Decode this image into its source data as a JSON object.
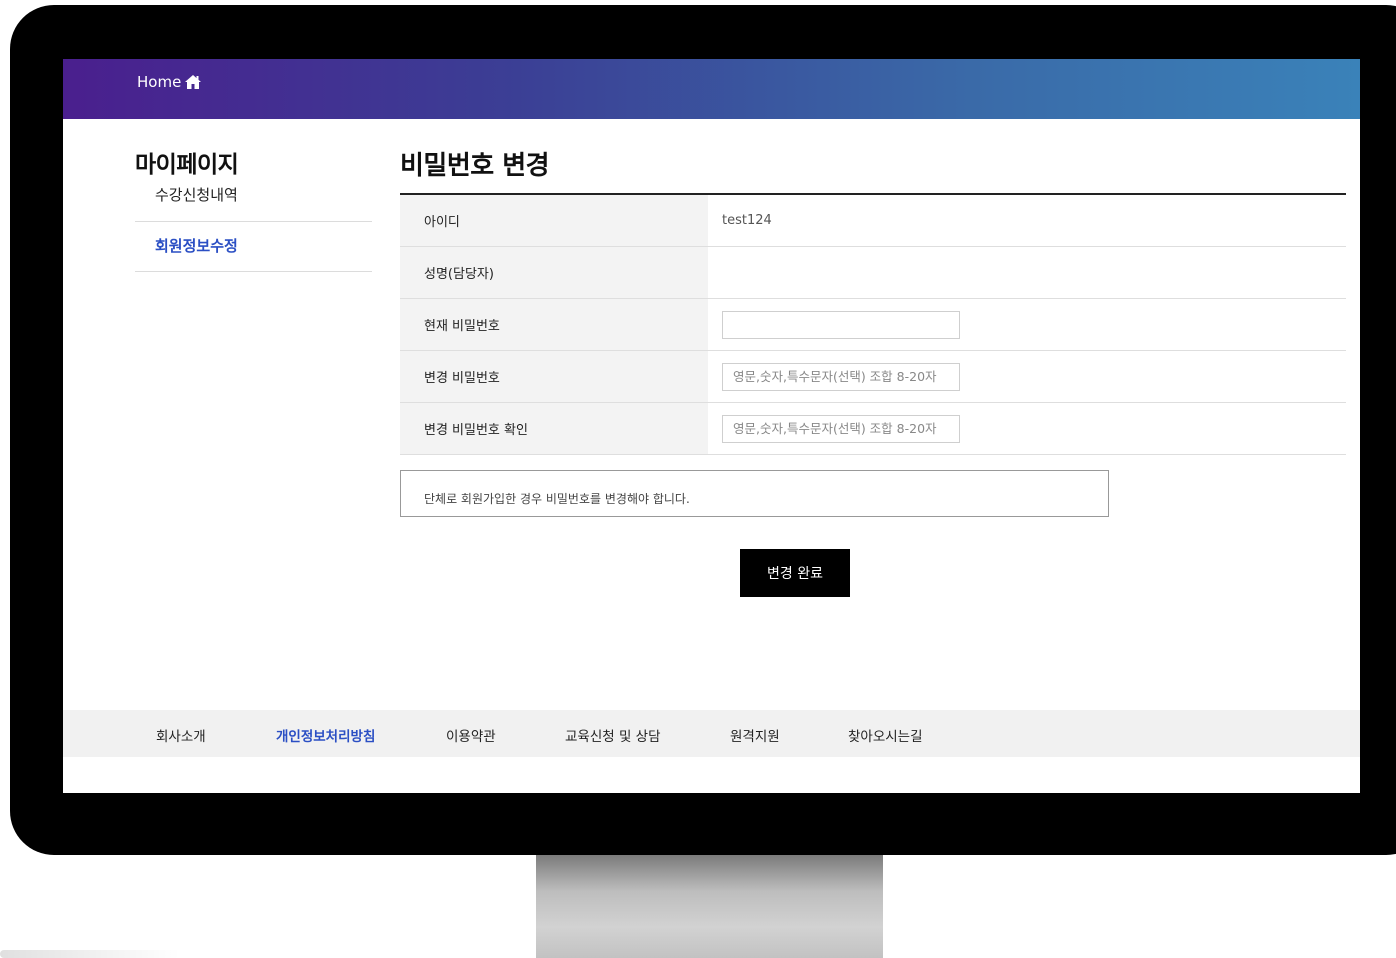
{
  "header": {
    "home_label": "Home",
    "home_icon": "house-icon"
  },
  "sidebar": {
    "title": "마이페이지",
    "items": [
      {
        "label": "수강신청내역",
        "active": false
      },
      {
        "label": "회원정보수정",
        "active": true
      }
    ]
  },
  "main": {
    "title": "비밀번호 변경",
    "rows": [
      {
        "label": "아이디",
        "value": "test124"
      },
      {
        "label": "성명(담당자)",
        "value": ""
      },
      {
        "label": "현재 비밀번호",
        "input_value": "",
        "placeholder": ""
      },
      {
        "label": "변경 비밀번호",
        "input_value": "",
        "placeholder": "영문,숫자,특수문자(선택) 조합 8-20자"
      },
      {
        "label": "변경 비밀번호 확인",
        "input_value": "",
        "placeholder": "영문,숫자,특수문자(선택) 조합 8-20자"
      }
    ],
    "notice": "단체로 회원가입한 경우 비밀번호를 변경해야 합니다.",
    "submit_label": "변경 완료"
  },
  "footer": {
    "links": [
      {
        "label": "회사소개",
        "active": false
      },
      {
        "label": "개인정보처리방침",
        "active": true
      },
      {
        "label": "이용약관",
        "active": false
      },
      {
        "label": "교육신청 및 상담",
        "active": false
      },
      {
        "label": "원격지원",
        "active": false
      },
      {
        "label": "찾아오시는길",
        "active": false
      }
    ]
  },
  "colors": {
    "active_link": "#2b4fc4",
    "header_start": "#4a1f8e",
    "header_end": "#3a82b9"
  }
}
